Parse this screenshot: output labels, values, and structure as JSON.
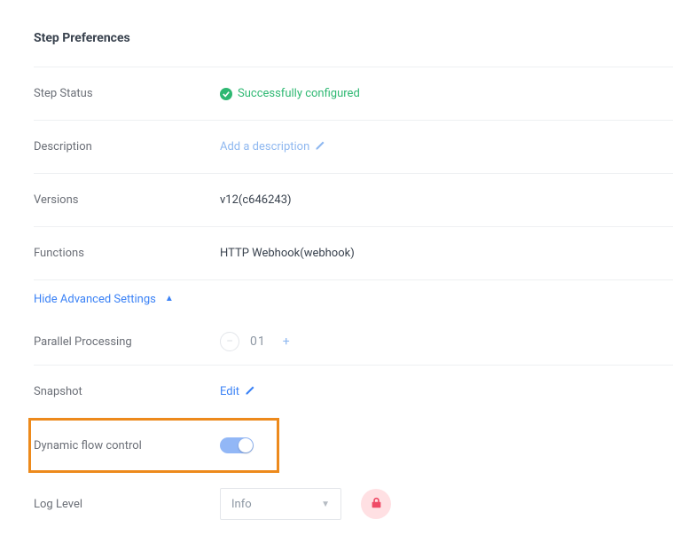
{
  "title": "Step Preferences",
  "rows": {
    "status": {
      "label": "Step Status",
      "value": "Successfully configured"
    },
    "description": {
      "label": "Description",
      "placeholder": "Add a description"
    },
    "versions": {
      "label": "Versions",
      "value": "v12(c646243)"
    },
    "functions": {
      "label": "Functions",
      "value": "HTTP Webhook(webhook)"
    }
  },
  "advanced": {
    "toggle_label": "Hide Advanced Settings",
    "parallel": {
      "label": "Parallel Processing",
      "value": "01"
    },
    "snapshot": {
      "label": "Snapshot",
      "action": "Edit"
    },
    "dynamic": {
      "label": "Dynamic flow control",
      "enabled": true
    },
    "loglevel": {
      "label": "Log Level",
      "value": "Info"
    }
  },
  "icons": {
    "check": "check-icon",
    "pencil": "pencil-icon",
    "caret_up": "caret-up-icon",
    "minus": "minus-icon",
    "plus": "plus-icon",
    "caret_down": "caret-down-icon",
    "lock": "lock-icon"
  }
}
